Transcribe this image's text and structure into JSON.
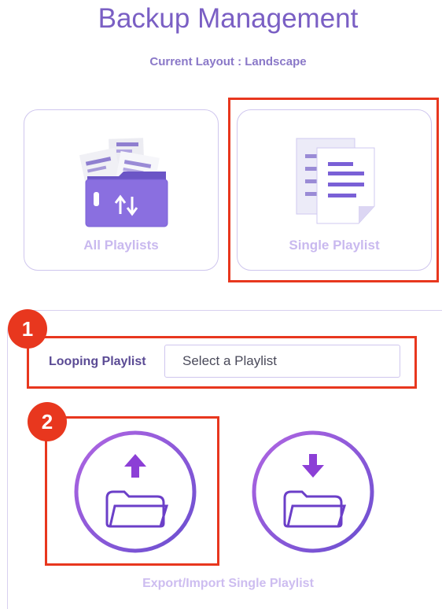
{
  "header": {
    "title": "Backup Management",
    "subtitle": "Current Layout : Landscape"
  },
  "cards": {
    "all_playlists": {
      "label": "All Playlists",
      "icon": "folder-transfer-icon"
    },
    "single_playlist": {
      "label": "Single Playlist",
      "icon": "documents-icon"
    }
  },
  "badges": {
    "one": "1",
    "two": "2"
  },
  "looping": {
    "label": "Looping Playlist",
    "select_value": "Select a Playlist"
  },
  "actions": {
    "export_icon": "folder-upload-icon",
    "import_icon": "folder-download-icon",
    "caption": "Export/Import Single Playlist"
  },
  "colors": {
    "accent": "#7a5fc4",
    "highlight": "#e8371e",
    "circle_gradient_start": "#a75ee0",
    "circle_gradient_end": "#6d4fd0"
  }
}
